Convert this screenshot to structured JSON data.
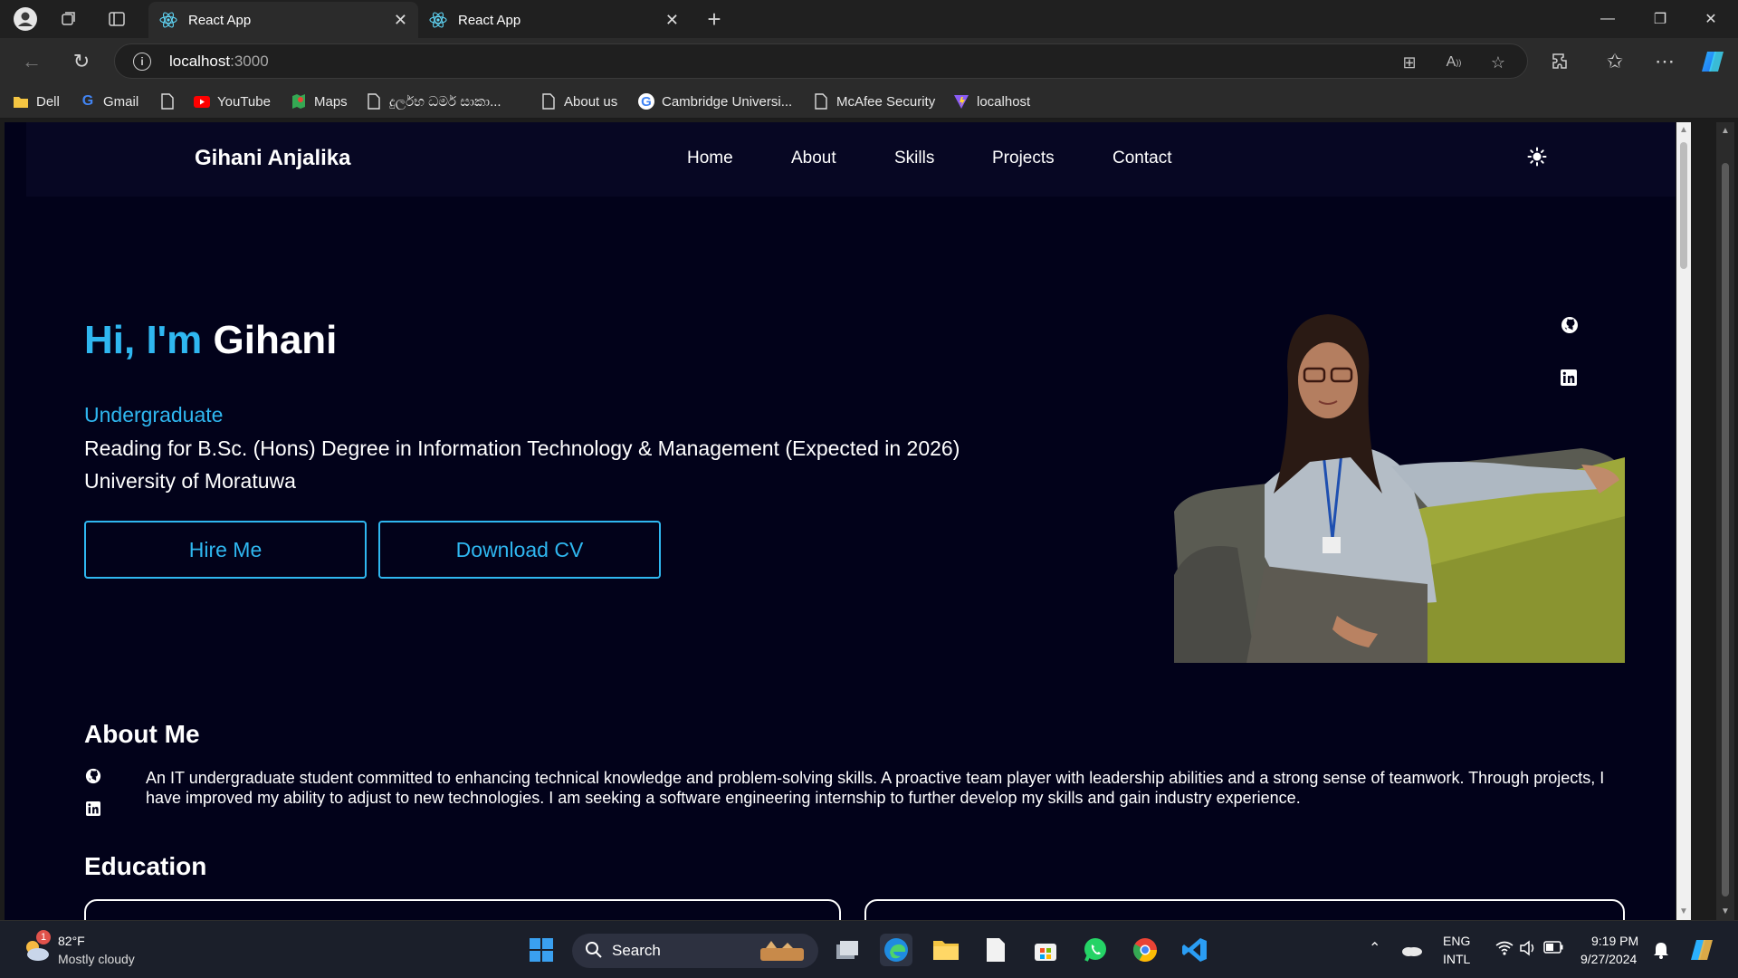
{
  "browser": {
    "tabs": [
      {
        "title": "React App",
        "active": true
      },
      {
        "title": "React App",
        "active": false
      }
    ],
    "address": {
      "host": "localhost",
      "port": ":3000"
    },
    "bookmarks": [
      "Dell",
      "Gmail",
      "YouTube",
      "Maps",
      "දුර්ලභ ධර්ම සාකා...",
      "About us",
      "Cambridge Universi...",
      "McAfee Security",
      "localhost"
    ]
  },
  "site": {
    "brand": "Gihani Anjalika",
    "nav": [
      "Home",
      "About",
      "Skills",
      "Projects",
      "Contact"
    ],
    "hero": {
      "greeting": "Hi, I'm",
      "name": "Gihani",
      "role": "Undergraduate",
      "line1": "Reading for B.Sc. (Hons) Degree in Information Technology & Management (Expected in 2026)",
      "line2": "University of Moratuwa",
      "hire_button": "Hire Me",
      "cv_button": "Download CV"
    },
    "about": {
      "title": "About Me",
      "text": "An IT undergraduate student committed to enhancing technical knowledge and problem-solving skills. A proactive team player with leadership abilities and a strong sense of teamwork. Through projects, I have improved my ability to adjust to new technologies. I am seeking a software engineering internship to further develop my skills and gain industry experience."
    },
    "education": {
      "title": "Education"
    },
    "colors": {
      "accent": "#2fb7f0",
      "background": "#02021a",
      "nav_background": "#070723"
    }
  },
  "taskbar": {
    "weather": {
      "temp": "82°F",
      "desc": "Mostly cloudy",
      "badge": "1"
    },
    "search_label": "Search",
    "lang": {
      "top": "ENG",
      "bottom": "INTL"
    },
    "clock": {
      "time": "9:19 PM",
      "date": "9/27/2024"
    }
  }
}
